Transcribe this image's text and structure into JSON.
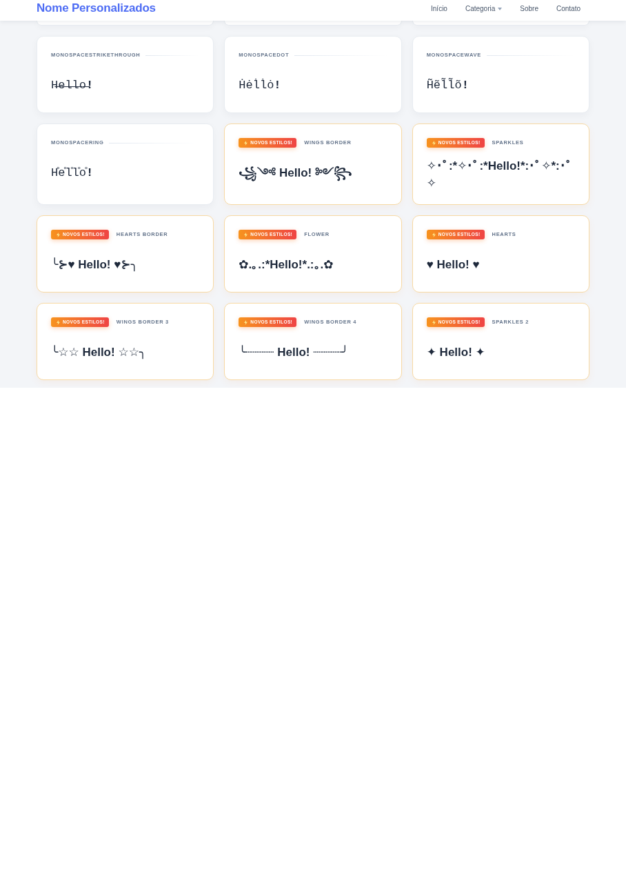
{
  "navbar": {
    "brand": "Nome Personalizados",
    "links": [
      {
        "label": "Início",
        "kind": "link"
      },
      {
        "label": "Categoria",
        "kind": "dropdown"
      },
      {
        "label": "Sobre",
        "kind": "link"
      },
      {
        "label": "Contato",
        "kind": "link"
      }
    ]
  },
  "cards": [
    {
      "label": "MONOSPACESTRIKETHROUGH",
      "kind": "monospace",
      "sample": "H̶e̶l̶l̶o̶**!**"
    },
    {
      "label": "MONOSPACEDOT",
      "kind": "monospace",
      "sample": "Ḣėl̇l̇ȯ**!**"
    },
    {
      "label": "MONOSPACEWAVE",
      "kind": "monospace",
      "sample": "H̃ẽl̃l̃õ**!**"
    },
    {
      "label": "MONOSPACERING",
      "kind": "monospace",
      "sample": "H̊e̊l̊l̊o̊**!**"
    },
    {
      "badge": "NOVOS ESTILOS!",
      "label": "WINGS BORDER",
      "kind": "decorated",
      "sample": "꧁༺ Hello! ༻꧂"
    },
    {
      "badge": "NOVOS ESTILOS!",
      "label": "SPARKLES",
      "kind": "decorated",
      "sample": "✧･ﾟ:*✧･ﾟ:*Hello!*:･ﾟ✧*:･ﾟ✧"
    },
    {
      "badge": "NOVOS ESTILOS!",
      "label": "HEARTS BORDER",
      "kind": "decorated",
      "sample": "╰⊱♥ Hello! ♥⊱╮"
    },
    {
      "badge": "NOVOS ESTILOS!",
      "label": "FLOWER",
      "kind": "decorated",
      "sample": "✿.｡.:*Hello!*.:｡.✿"
    },
    {
      "badge": "NOVOS ESTILOS!",
      "label": "HEARTS",
      "kind": "decorated",
      "sample": "♥ Hello! ♥"
    },
    {
      "badge": "NOVOS ESTILOS!",
      "label": "WINGS BORDER 3",
      "kind": "decorated",
      "sample": "╰☆☆ Hello! ☆☆╮"
    },
    {
      "badge": "NOVOS ESTILOS!",
      "label": "WINGS BORDER 4",
      "kind": "decorated",
      "sample": "╰┈┈┈┈ Hello! ┈┈┈┈╯"
    },
    {
      "badge": "NOVOS ESTILOS!",
      "label": "SPARKLES 2",
      "kind": "decorated",
      "sample": "✦ Hello! ✦"
    }
  ]
}
